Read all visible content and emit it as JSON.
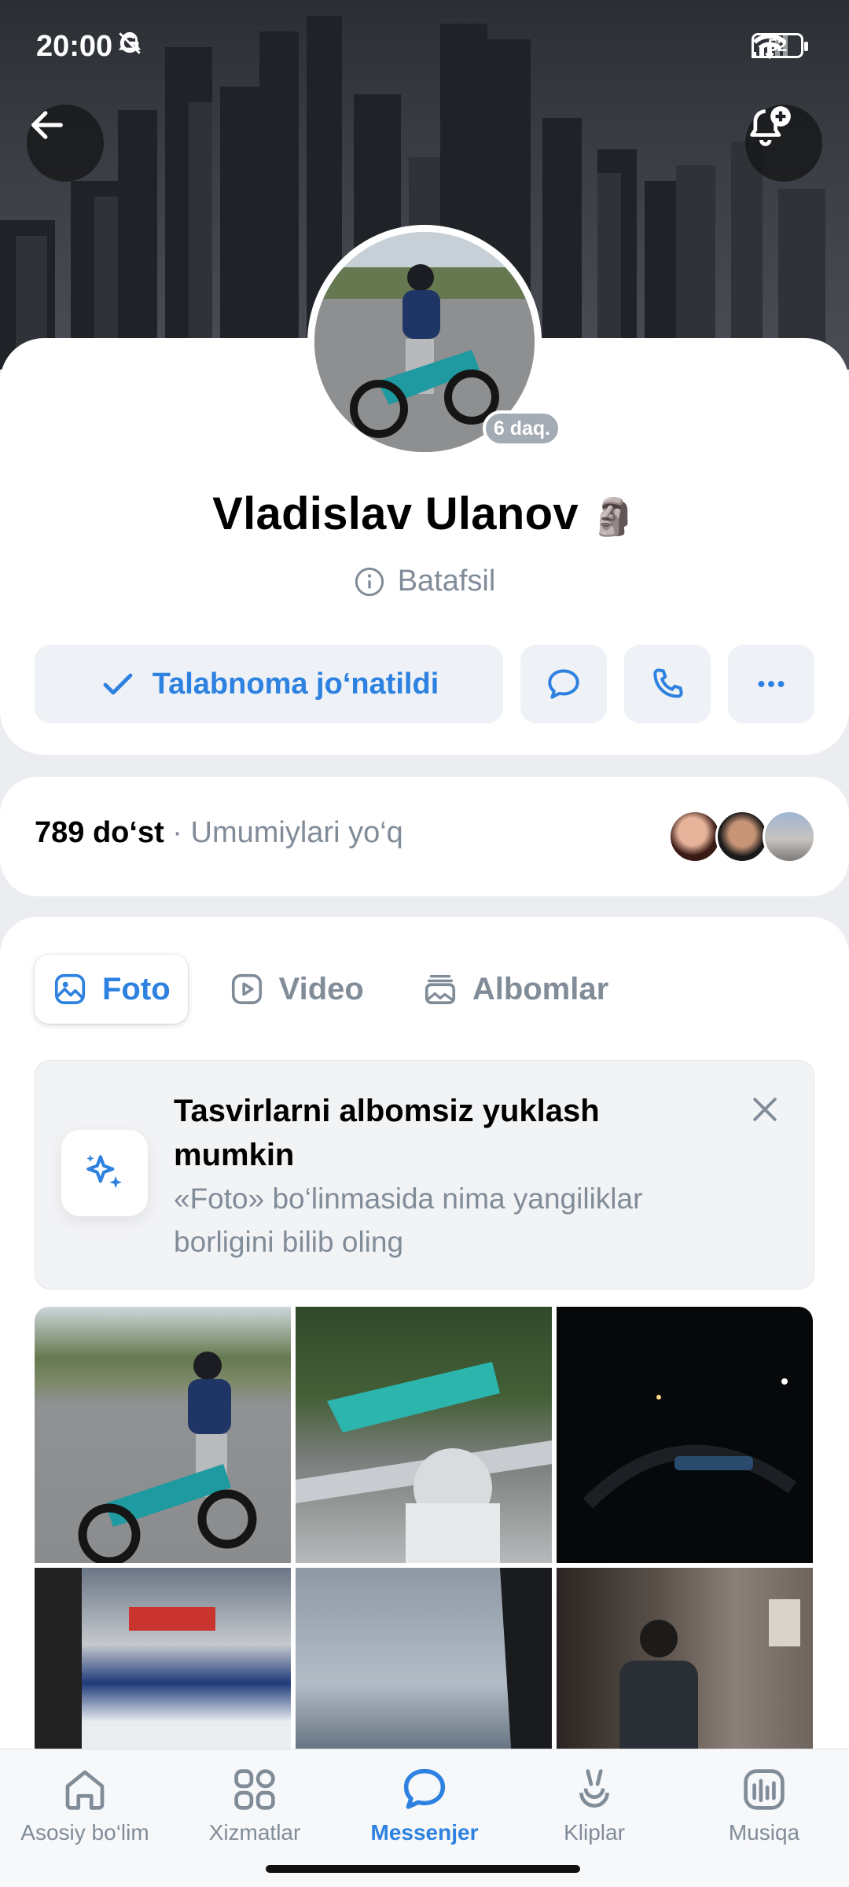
{
  "status_bar": {
    "time": "20:00",
    "battery": "52"
  },
  "profile": {
    "name": "Vladislav Ulanov",
    "name_emoji": "🗿",
    "online_badge": "6 daq.",
    "details_label": "Batafsil"
  },
  "actions": {
    "request_label": "Talabnoma jo‘natildi",
    "message_icon": "message-icon",
    "call_icon": "phone-icon",
    "more_icon": "more-icon"
  },
  "friends": {
    "count_label": "789 do‘st",
    "separator": "·",
    "common_label": "Umumiylari yo‘q"
  },
  "tabs": [
    {
      "label": "Foto",
      "icon": "photo-icon",
      "active": true
    },
    {
      "label": "Video",
      "icon": "video-icon",
      "active": false
    },
    {
      "label": "Albomlar",
      "icon": "albums-icon",
      "active": false
    }
  ],
  "promo": {
    "title": "Tasvirlarni albomsiz yuklash mumkin",
    "subtitle": "«Foto» bo‘linmasida nima yangiliklar borligini bilib oling"
  },
  "bottom_nav": [
    {
      "label": "Asosiy bo‘lim",
      "icon": "home-icon",
      "active": false
    },
    {
      "label": "Xizmatlar",
      "icon": "services-icon",
      "active": false
    },
    {
      "label": "Messenjer",
      "icon": "messenger-icon",
      "active": true
    },
    {
      "label": "Kliplar",
      "icon": "clips-icon",
      "active": false
    },
    {
      "label": "Musiqa",
      "icon": "music-icon",
      "active": false
    }
  ],
  "colors": {
    "accent": "#2d81e0",
    "secondary_text": "#818c99",
    "background": "#ebedf0"
  }
}
